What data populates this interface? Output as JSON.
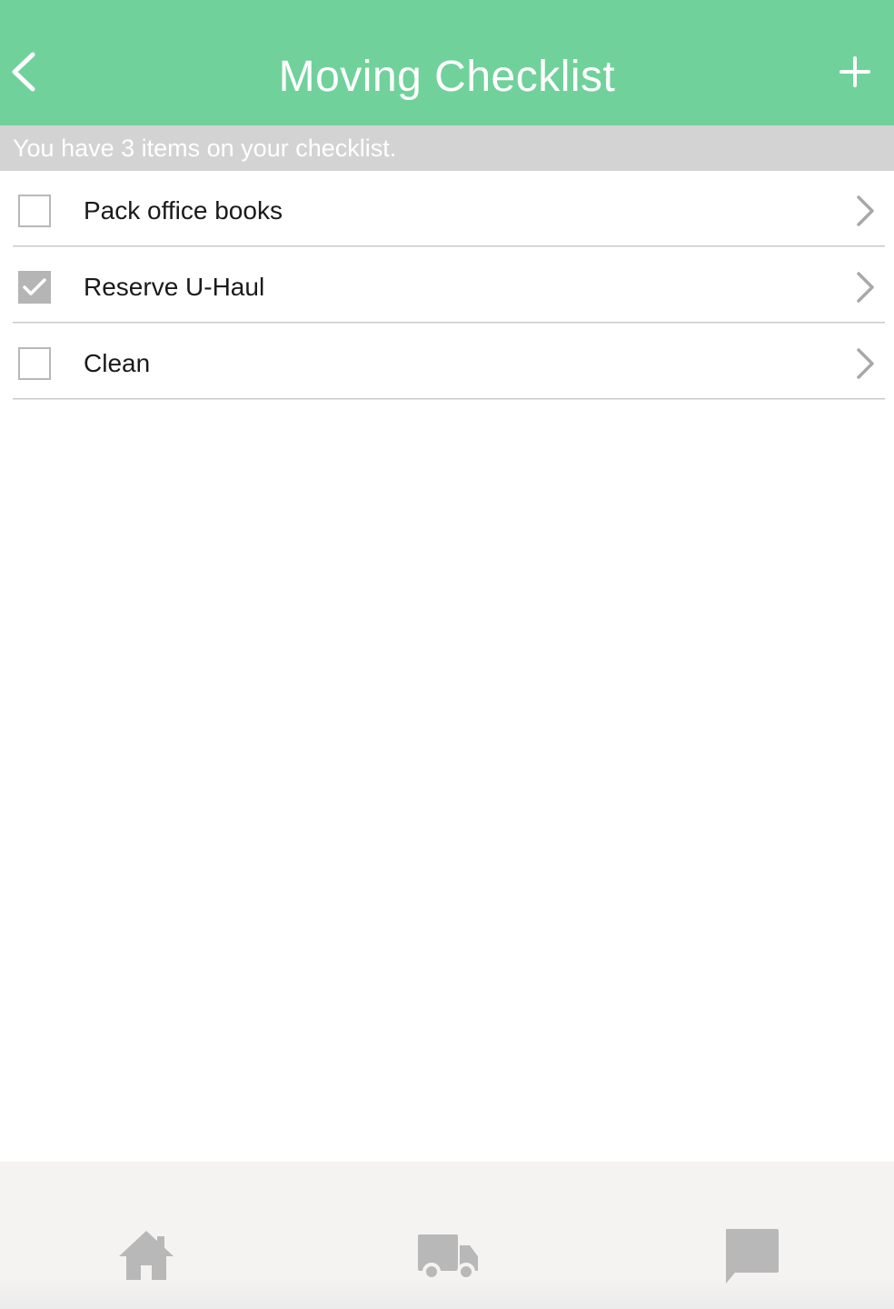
{
  "header": {
    "title": "Moving Checklist",
    "back_icon": "chevron-left-icon",
    "add_icon": "plus-icon",
    "background": "#71d19b"
  },
  "summary": {
    "text": "You have 3 items on your checklist.",
    "background": "#d3d3d3"
  },
  "checklist": {
    "items": [
      {
        "label": "Pack office books",
        "checked": false
      },
      {
        "label": "Reserve U-Haul",
        "checked": true
      },
      {
        "label": "Clean",
        "checked": false
      }
    ]
  },
  "bottom_nav": {
    "items": [
      {
        "icon": "home-icon"
      },
      {
        "icon": "truck-icon"
      },
      {
        "icon": "chat-icon"
      }
    ],
    "icon_color": "#b8b8b8"
  }
}
